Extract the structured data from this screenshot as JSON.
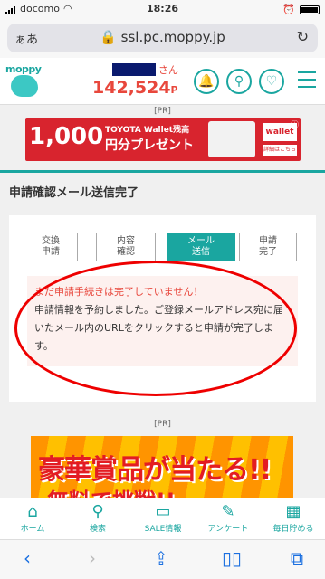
{
  "status": {
    "carrier": "docomo",
    "time": "18:26"
  },
  "browser": {
    "aa": "ぁあ",
    "url": "ssl.pc.moppy.jp",
    "lock_icon": "lock-icon",
    "reload_icon": "reload-icon"
  },
  "header": {
    "logo": "moppy",
    "honorific": "さん",
    "points": "142,524",
    "points_unit": "P"
  },
  "pr_label": "[PR]",
  "banner1": {
    "big": "1,000",
    "top": "TOYOTA Wallet残高",
    "yen": "円分プレゼント",
    "wallet": "wallet",
    "detail": "詳細はこちら ≫",
    "info": "ⓘ"
  },
  "page_title": "申請確認メール送信完了",
  "steps": [
    {
      "label": "交換\n申請",
      "active": false
    },
    {
      "label": "内容\n確認",
      "active": false
    },
    {
      "label": "メール\n送信",
      "active": true
    },
    {
      "label": "申請\n完了",
      "active": false
    }
  ],
  "notice": {
    "warning": "まだ申請手続きは完了していません！",
    "body": "申請情報を予約しました。ご登録メールアドレス宛に届いたメール内のURLをクリックすると申請が完了します。"
  },
  "banner2": {
    "line1": "豪華賞品が当たる!!",
    "line2": "無料で挑戦!!"
  },
  "tabs": [
    {
      "label": "ホーム",
      "icon": "home-icon"
    },
    {
      "label": "検索",
      "icon": "search-icon"
    },
    {
      "label": "SALE情報",
      "icon": "sale-icon"
    },
    {
      "label": "アンケート",
      "icon": "survey-icon"
    },
    {
      "label": "毎日貯める",
      "icon": "daily-icon"
    }
  ],
  "colors": {
    "brand": "#1aa6a0",
    "accent": "#e8473c",
    "annotation": "#ee0000"
  }
}
